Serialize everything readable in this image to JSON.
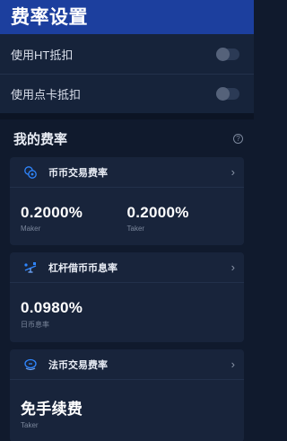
{
  "header": {
    "title": "费率设置"
  },
  "settings": [
    {
      "label": "使用HT抵扣",
      "enabled": false
    },
    {
      "label": "使用点卡抵扣",
      "enabled": false
    }
  ],
  "rates": {
    "title": "我的费率",
    "help_icon": "?",
    "cards": [
      {
        "title": "币币交易费率",
        "icon": "coins-icon",
        "metrics": [
          {
            "value": "0.2000%",
            "label": "Maker"
          },
          {
            "value": "0.2000%",
            "label": "Taker"
          }
        ]
      },
      {
        "title": "杠杆借币币息率",
        "icon": "leverage-icon",
        "metrics": [
          {
            "value": "0.0980%",
            "label": "日币息率"
          }
        ]
      },
      {
        "title": "法币交易费率",
        "icon": "fiat-icon",
        "metrics": [
          {
            "value": "免手续费",
            "label": "Taker"
          }
        ]
      }
    ]
  },
  "colors": {
    "header": "#1c3f9e",
    "background": "#101a2d",
    "card": "#18243b",
    "icon_accent": "#2f86ff"
  }
}
